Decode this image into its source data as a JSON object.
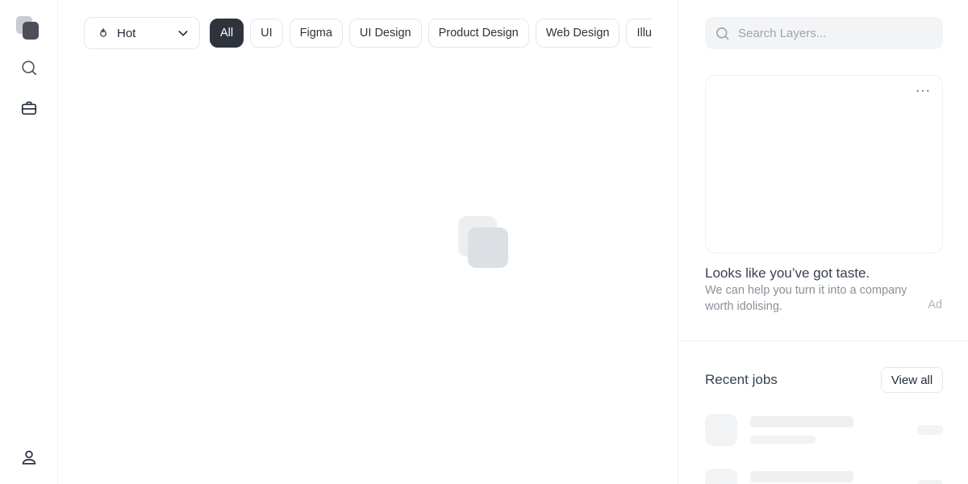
{
  "sort": {
    "label": "Hot"
  },
  "filters": [
    "All",
    "UI",
    "Figma",
    "UI Design",
    "Product Design",
    "Web Design",
    "Illustration"
  ],
  "search": {
    "placeholder": "Search Layers..."
  },
  "ad": {
    "menu_label": "···",
    "title": "Looks like you’ve got taste.",
    "description": "We can help you turn it into a company worth idolising.",
    "tag": "Ad"
  },
  "jobs": {
    "title": "Recent jobs",
    "view_all_label": "View all"
  },
  "colors": {
    "active_chip": "#2f343c",
    "border": "#e5e7eb",
    "muted_text": "#8a9099"
  }
}
